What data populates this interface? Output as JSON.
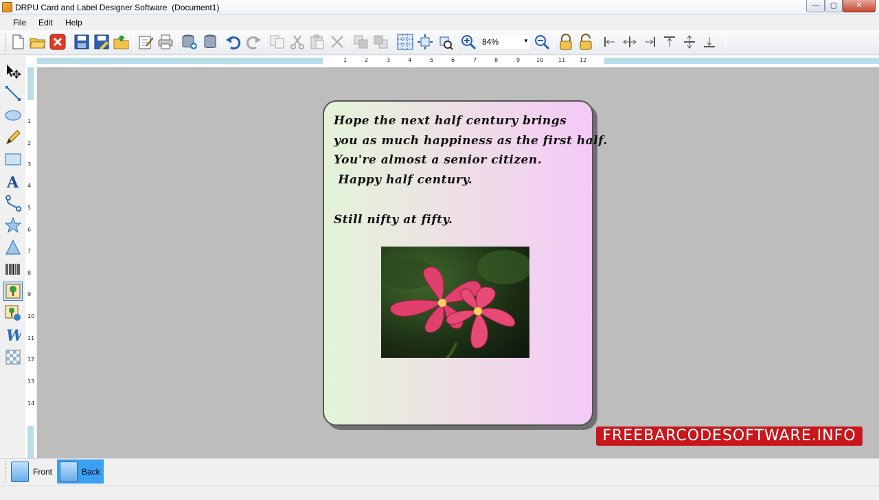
{
  "window": {
    "title": "DRPU Card and Label Designer Software  (Document1)",
    "minimize_glyph": "—",
    "maximize_glyph": "▢",
    "close_glyph": "✕"
  },
  "menu": [
    "File",
    "Edit",
    "Help"
  ],
  "toolbar": {
    "zoom_value": "84%",
    "buttons": [
      "new-icon",
      "open-icon",
      "close-icon",
      "save-icon",
      "save-as-icon",
      "export-icon",
      "edit-icon",
      "print-icon",
      "database-add-icon",
      "database-icon",
      "undo-icon",
      "redo-icon",
      "copy-icon",
      "cut-icon",
      "paste-icon",
      "delete-icon",
      "bring-forward-icon",
      "send-backward-icon",
      "grid-icon",
      "center-icon",
      "pan-icon",
      "zoom-in-icon",
      "zoom-out-icon",
      "lock-icon",
      "unlock-icon",
      "align-left-icon",
      "align-center-icon",
      "align-right-icon",
      "align-top-icon",
      "align-middle-icon",
      "align-bottom-icon"
    ]
  },
  "ruler": {
    "horizontal": [
      "1",
      "2",
      "3",
      "4",
      "5",
      "6",
      "7",
      "8",
      "9",
      "10",
      "11",
      "12"
    ],
    "vertical": [
      "1",
      "2",
      "3",
      "4",
      "5",
      "6",
      "7",
      "8",
      "9",
      "10",
      "11",
      "12",
      "13",
      "14"
    ]
  },
  "left_tools": [
    "select-icon",
    "line-icon",
    "ellipse-icon",
    "pencil-icon",
    "rectangle-icon",
    "text-icon",
    "curve-icon",
    "star-icon",
    "triangle-icon",
    "barcode-icon",
    "image-icon",
    "image-library-icon",
    "wordart-icon",
    "watermark-icon"
  ],
  "card": {
    "lines": [
      "Hope the next half century brings",
      "you as much happiness as the first half.",
      "You're almost a senior citizen.",
      " Happy half century.",
      "Still nifty at fifty."
    ],
    "image_alt": "pink plumeria flowers"
  },
  "watermark": "FREEBARCODESOFTWARE.INFO",
  "pages": {
    "front": "Front",
    "back": "Back"
  },
  "colors": {
    "accent": "#3aa1f2",
    "watermark": "#c8161b",
    "card_left": "#e3f4d8",
    "card_right": "#f4c9f7"
  }
}
